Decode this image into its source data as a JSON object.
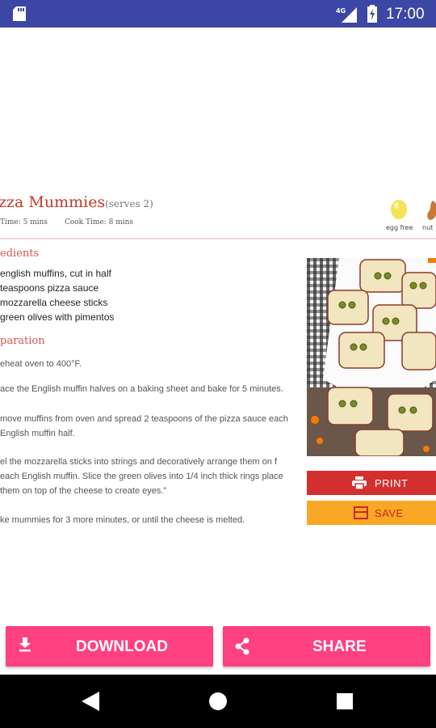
{
  "status_bar": {
    "network": "4G",
    "time": "17:00"
  },
  "recipe": {
    "title": "zza Mummies",
    "serves": "(serves 2)",
    "prep_time": "Time: 5 mins",
    "cook_time": "Cook Time: 8 mins",
    "badges": [
      {
        "label": "egg free",
        "icon": "egg-icon"
      },
      {
        "label": "nut",
        "icon": "nut-icon"
      }
    ],
    "ingredients_heading": "edients",
    "ingredients": [
      "english muffins, cut in half",
      "teaspoons pizza sauce",
      "mozzarella cheese sticks",
      "green olives with pimentos"
    ],
    "preparation_heading": "paration",
    "steps": [
      "eheat oven to 400°F.",
      "ace the English muffin halves on a baking sheet and bake for 5 minutes.",
      "move muffins from oven and spread 2 teaspoons of the pizza sauce each English muffin half.",
      "el the mozzarella sticks into strings and decoratively arrange them on f each English muffin. Slice the green olives into 1/4 inch thick rings place them on top of the cheese to create eyes.\"",
      "ke mummies for 3 more minutes, or until the cheese is melted."
    ]
  },
  "actions": {
    "print_label": "PRINT",
    "save_label": "SAVE"
  },
  "bottom_bar": {
    "download_label": "DOWNLOAD",
    "share_label": "SHARE"
  },
  "colors": {
    "status_bar": "#3b46a5",
    "accent_pink": "#ff4081",
    "print_red": "#d32f2f",
    "save_yellow": "#f9a825",
    "title_red": "#c0392b"
  }
}
